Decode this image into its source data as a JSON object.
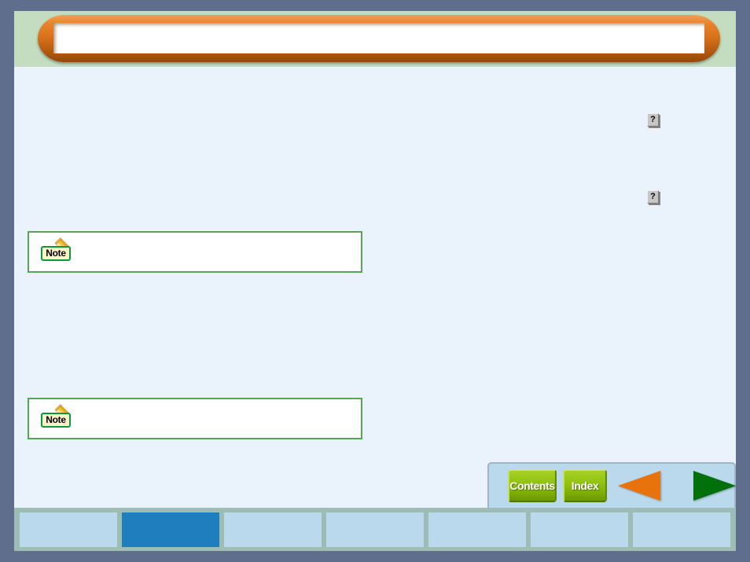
{
  "header": {
    "title": ""
  },
  "help_buttons": [
    {
      "name": "help-button-top",
      "label": "?"
    },
    {
      "name": "help-button-middle",
      "label": "?"
    }
  ],
  "notes": [
    {
      "badge_label": "Note",
      "icon": "pencil-icon",
      "text": ""
    },
    {
      "badge_label": "Note",
      "icon": "pencil-icon",
      "text": ""
    }
  ],
  "nav": {
    "contents_label": "Contents",
    "index_label": "Index",
    "prev_icon": "triangle-left-icon",
    "next_icon": "triangle-right-icon"
  },
  "tabs": [
    {
      "label": "",
      "selected": false
    },
    {
      "label": "",
      "selected": true
    },
    {
      "label": "",
      "selected": false
    },
    {
      "label": "",
      "selected": false
    },
    {
      "label": "",
      "selected": false
    },
    {
      "label": "",
      "selected": false
    },
    {
      "label": "",
      "selected": false
    }
  ],
  "colors": {
    "page_background": "#5f6e8c",
    "header_band": "#c4ddc0",
    "banner_orange": "#e8812a",
    "content_background": "#eaf3fb",
    "note_border": "#54a654",
    "note_badge_fill": "#fdf3c7",
    "note_badge_border": "#0a9c3c",
    "nav_panel": "#bad9ed",
    "nav_button_green": "#93c413",
    "arrow_prev": "#e8730c",
    "arrow_next": "#00700a",
    "tab_strip": "#9dbdb4",
    "tab": "#bad9ed",
    "tab_selected": "#1e7ebe"
  }
}
